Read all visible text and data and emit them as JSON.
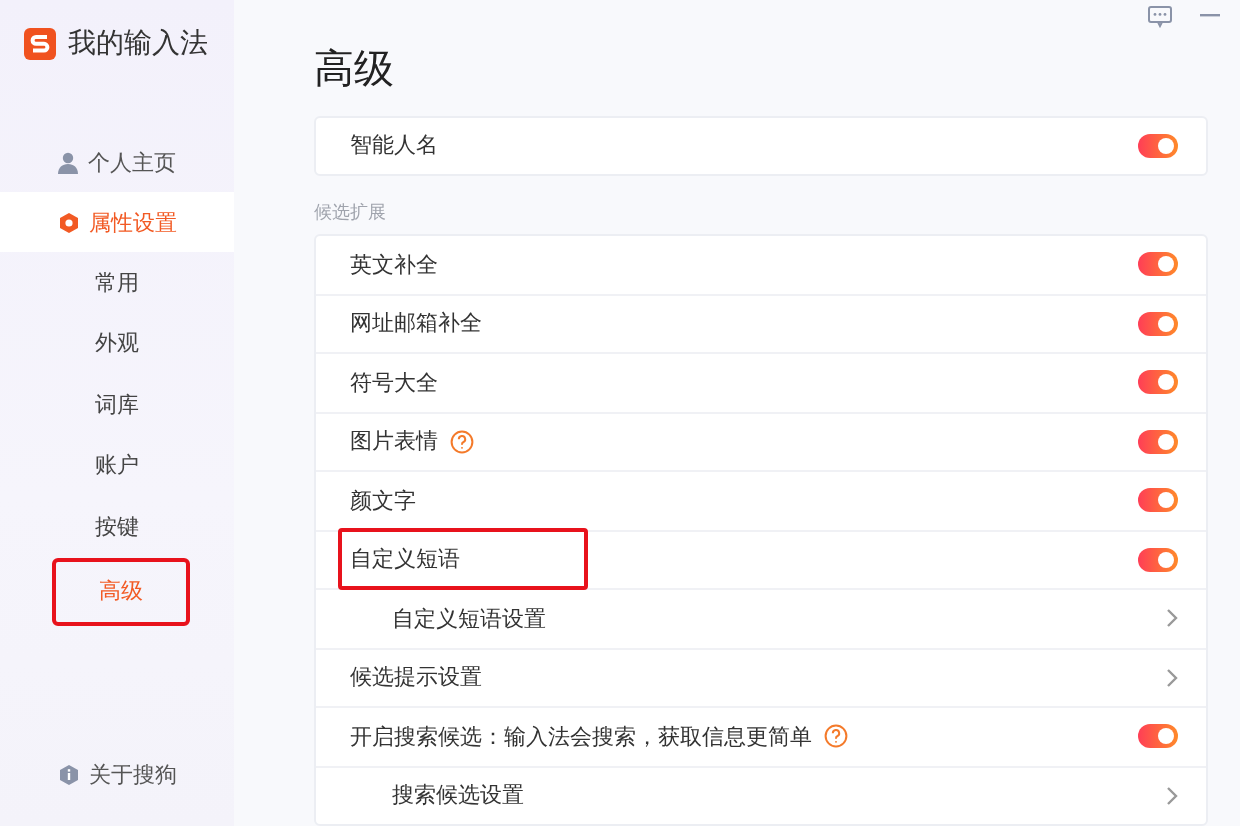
{
  "app": {
    "title": "我的输入法"
  },
  "sidebar": {
    "items": [
      {
        "label": "个人主页",
        "selected": false
      },
      {
        "label": "属性设置",
        "selected": true,
        "children": [
          {
            "label": "常用",
            "selected": false,
            "highlighted": false
          },
          {
            "label": "外观",
            "selected": false,
            "highlighted": false
          },
          {
            "label": "词库",
            "selected": false,
            "highlighted": false
          },
          {
            "label": "账户",
            "selected": false,
            "highlighted": false
          },
          {
            "label": "按键",
            "selected": false,
            "highlighted": false
          },
          {
            "label": "高级",
            "selected": true,
            "highlighted": true
          }
        ]
      }
    ],
    "footer": {
      "label": "关于搜狗"
    }
  },
  "page": {
    "title": "高级",
    "top_rows": [
      {
        "kind": "toggle",
        "label": "智能人名",
        "on": true,
        "help": false,
        "highlighted": false
      }
    ],
    "sections": [
      {
        "label": "候选扩展",
        "rows": [
          {
            "kind": "toggle",
            "label": "英文补全",
            "on": true,
            "help": false,
            "highlighted": false
          },
          {
            "kind": "toggle",
            "label": "网址邮箱补全",
            "on": true,
            "help": false,
            "highlighted": false
          },
          {
            "kind": "toggle",
            "label": "符号大全",
            "on": true,
            "help": false,
            "highlighted": false
          },
          {
            "kind": "toggle",
            "label": "图片表情",
            "on": true,
            "help": true,
            "highlighted": false
          },
          {
            "kind": "toggle",
            "label": "颜文字",
            "on": true,
            "help": false,
            "highlighted": false
          },
          {
            "kind": "toggle",
            "label": "自定义短语",
            "on": true,
            "help": false,
            "highlighted": true,
            "children": [
              {
                "kind": "link",
                "label": "自定义短语设置",
                "help": false,
                "highlighted": false
              }
            ]
          },
          {
            "kind": "link",
            "label": "候选提示设置",
            "help": false,
            "highlighted": false
          },
          {
            "kind": "toggle",
            "label": "开启搜索候选：输入法会搜索，获取信息更简单",
            "on": true,
            "help": true,
            "highlighted": false,
            "children": [
              {
                "kind": "link",
                "label": "搜索候选设置",
                "help": false,
                "highlighted": false
              }
            ]
          }
        ]
      }
    ]
  }
}
